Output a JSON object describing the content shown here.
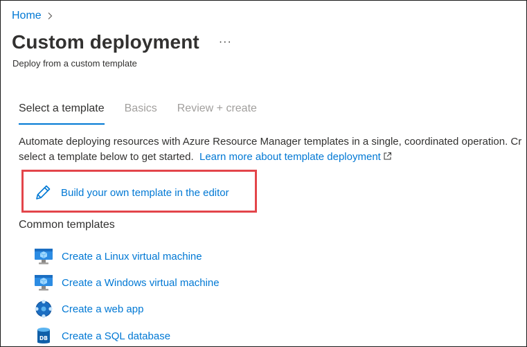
{
  "breadcrumb": {
    "home": "Home"
  },
  "header": {
    "title": "Custom deployment",
    "more": "···",
    "subtitle": "Deploy from a custom template"
  },
  "tabs": [
    {
      "label": "Select a template",
      "state": "active"
    },
    {
      "label": "Basics",
      "state": "disabled"
    },
    {
      "label": "Review + create",
      "state": "disabled"
    }
  ],
  "description": {
    "line1": "Automate deploying resources with Azure Resource Manager templates in a single, coordinated operation. Cr",
    "line2_prefix": "select a template below to get started.",
    "learn_more": "Learn more about template deployment"
  },
  "build_template": {
    "label": "Build your own template in the editor",
    "icon": "pencil-icon"
  },
  "common_templates": {
    "heading": "Common templates",
    "items": [
      {
        "label": "Create a Linux virtual machine",
        "icon": "virtual-machine-icon"
      },
      {
        "label": "Create a Windows virtual machine",
        "icon": "virtual-machine-icon"
      },
      {
        "label": "Create a web app",
        "icon": "web-app-icon"
      },
      {
        "label": "Create a SQL database",
        "icon": "sql-database-icon"
      }
    ]
  },
  "colors": {
    "link": "#0078d4",
    "highlight_border": "#e3454a",
    "text": "#323130",
    "disabled": "#a19f9d"
  }
}
